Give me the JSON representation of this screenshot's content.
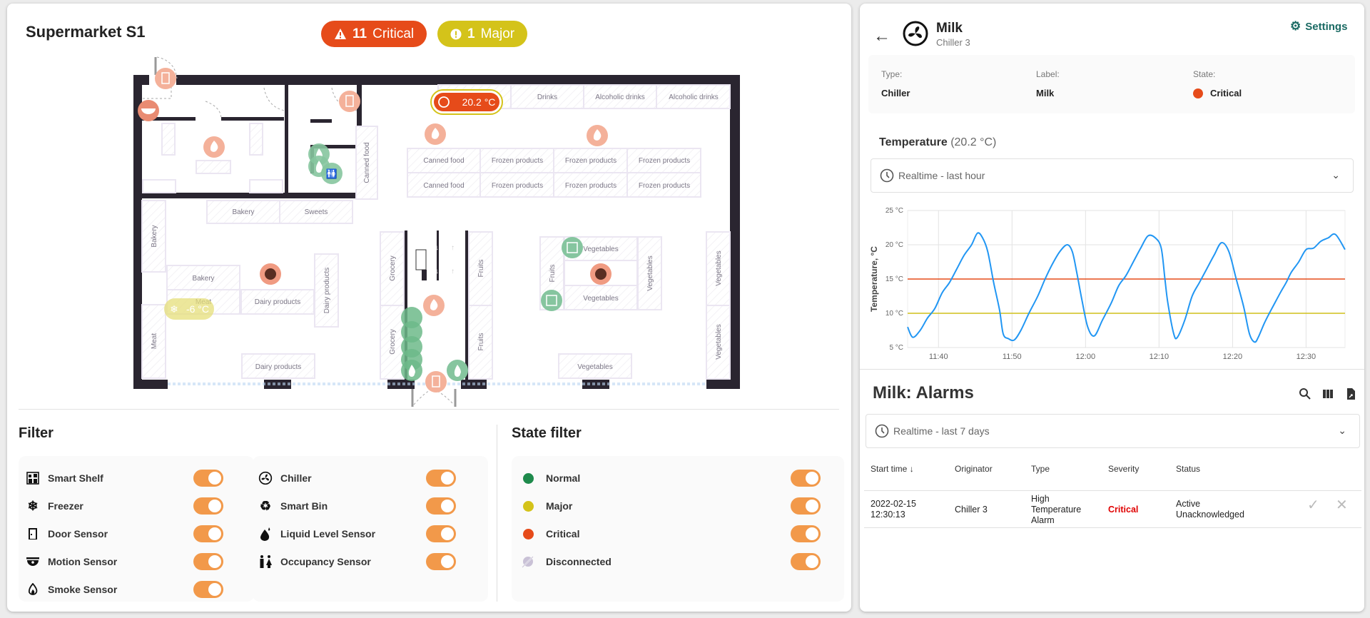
{
  "left": {
    "title": "Supermarket S1",
    "badges": {
      "critical": {
        "count": "11",
        "label": "Critical",
        "color": "#e64b1a"
      },
      "major": {
        "count": "1",
        "label": "Major",
        "color": "#d4c31a"
      }
    },
    "plan": {
      "chiller_readout": "20.2 °C",
      "freezer_readout": "-6 °C",
      "shelves": {
        "drinks": "Drinks",
        "alcohol1": "Alcoholic drinks",
        "alcohol2": "Alcoholic drinks",
        "canned_v": "Canned food",
        "canned1": "Canned food",
        "canned2": "Canned food",
        "frozen": "Frozen products",
        "bakery_top": "Bakery",
        "sweets": "Sweets",
        "bakery_v": "Bakery",
        "bakery": "Bakery",
        "meat": "Meat",
        "meat_v": "Meat",
        "dairy1": "Dairy products",
        "dairy_v": "Dairy products",
        "dairy2": "Dairy products",
        "grocery": "Grocery",
        "fruits": "Fruits",
        "vegetables": "Vegetables"
      }
    },
    "filter": {
      "title": "Filter",
      "col1": [
        {
          "label": "Smart Shelf",
          "icon": "smart-shelf-icon",
          "on": true
        },
        {
          "label": "Freezer",
          "icon": "snowflake-icon",
          "on": true
        },
        {
          "label": "Door Sensor",
          "icon": "door-icon",
          "on": true
        },
        {
          "label": "Motion Sensor",
          "icon": "motion-sensor-icon",
          "on": true
        },
        {
          "label": "Smoke Sensor",
          "icon": "flame-icon",
          "on": true
        }
      ],
      "col2": [
        {
          "label": "Chiller",
          "icon": "fan-icon",
          "on": true
        },
        {
          "label": "Smart Bin",
          "icon": "recycle-icon",
          "on": true
        },
        {
          "label": "Liquid Level Sensor",
          "icon": "droplet-icon",
          "on": true
        },
        {
          "label": "Occupancy Sensor",
          "icon": "people-icon",
          "on": true
        }
      ]
    },
    "state_filter": {
      "title": "State filter",
      "items": [
        {
          "label": "Normal",
          "color": "#1e8a4c",
          "on": true
        },
        {
          "label": "Major",
          "color": "#d4c31a",
          "on": true
        },
        {
          "label": "Critical",
          "color": "#e64b1a",
          "on": true
        },
        {
          "label": "Disconnected",
          "color": "#c9c1d6",
          "on": true
        }
      ]
    }
  },
  "right": {
    "device": {
      "name": "Milk",
      "subtitle": "Chiller 3"
    },
    "settings_label": "Settings",
    "info": {
      "type_label": "Type:",
      "type_value": "Chiller",
      "label_label": "Label:",
      "label_value": "Milk",
      "state_label": "State:",
      "state_value": "Critical",
      "state_color": "#e64b1a"
    },
    "temperature": {
      "title": "Temperature",
      "current": "(20.2 °C)",
      "timewindow": "Realtime - last hour"
    },
    "alarms": {
      "title": "Milk: Alarms",
      "timewindow": "Realtime - last 7 days",
      "columns": [
        "Start time",
        "Originator",
        "Type",
        "Severity",
        "Status"
      ],
      "rows": [
        {
          "start_date": "2022-02-15",
          "start_time": "12:30:13",
          "originator": "Chiller 3",
          "type_l1": "High",
          "type_l2": "Temperature",
          "type_l3": "Alarm",
          "severity": "Critical",
          "status_l1": "Active",
          "status_l2": "Unacknowledged"
        }
      ]
    }
  },
  "chart_data": {
    "type": "line",
    "title": "",
    "ylabel": "Temperature, °C",
    "xlabel": "",
    "ylim": [
      5,
      25
    ],
    "yticks": [
      "5 °C",
      "10 °C",
      "15 °C",
      "20 °C",
      "25 °C"
    ],
    "ytick_values": [
      5,
      10,
      15,
      20,
      25
    ],
    "xticks": [
      "11:40",
      "11:50",
      "12:00",
      "12:10",
      "12:20",
      "12:30"
    ],
    "xtick_minutes": [
      40,
      50,
      60,
      70,
      80,
      90
    ],
    "xlim_minutes": [
      35.8,
      95.3
    ],
    "grid": true,
    "thresholds": [
      {
        "name": "critical",
        "value": 15,
        "color": "#e64b1a"
      },
      {
        "name": "major",
        "value": 10,
        "color": "#cfbf1a"
      }
    ],
    "series": [
      {
        "name": "Temperature",
        "color": "#2196f3",
        "x_minutes": [
          35.8,
          36.5,
          37.5,
          38.5,
          39.5,
          40.5,
          41.5,
          42.5,
          43.5,
          44.5,
          45.3,
          46,
          46.7,
          47.5,
          48.3,
          48.8,
          49.5,
          50.3,
          51.2,
          52.3,
          53.5,
          54.5,
          55.5,
          56.5,
          57.5,
          58.2,
          58.8,
          59.5,
          60.3,
          61.2,
          62.3,
          63.5,
          64.5,
          65.5,
          66.5,
          67.5,
          68.5,
          69.5,
          70.3,
          70.8,
          71.2,
          72,
          72.5,
          73.5,
          74.5,
          75.5,
          76.5,
          77.5,
          78.5,
          79.5,
          80.5,
          81.5,
          82.3,
          83,
          83.5,
          84.3,
          85,
          85.5,
          86.5,
          87.3,
          88,
          89,
          90,
          91,
          92,
          93,
          94,
          95.3
        ],
        "values": [
          8,
          6.5,
          7.5,
          9.3,
          10.7,
          13,
          14.5,
          16.5,
          18.5,
          20,
          21.7,
          21,
          19,
          14.5,
          10.5,
          7,
          6.3,
          6.1,
          7.5,
          10,
          12.5,
          15,
          17.2,
          19,
          20,
          19,
          16,
          12,
          8,
          6.7,
          9,
          11.5,
          14,
          15.5,
          17.5,
          19.5,
          21.3,
          21,
          19.5,
          15,
          11.5,
          7,
          6.5,
          9,
          12.5,
          14.5,
          16.5,
          18.5,
          20.3,
          19,
          15,
          11,
          7,
          5.8,
          6.5,
          8.5,
          10,
          11,
          13,
          14.5,
          16,
          17.5,
          19.3,
          19.5,
          20.5,
          21,
          21.5,
          19.3
        ]
      }
    ]
  }
}
